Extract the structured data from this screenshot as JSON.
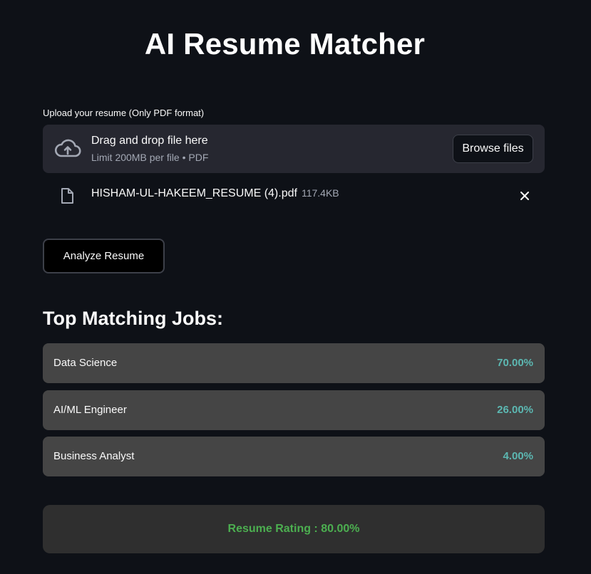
{
  "app": {
    "title": "AI Resume Matcher"
  },
  "uploader": {
    "label": "Upload your resume (Only PDF format)",
    "drop_title": "Drag and drop file here",
    "drop_subtitle": "Limit 200MB per file • PDF",
    "browse_label": "Browse files",
    "upload_icon": "cloud-upload-icon",
    "file": {
      "name": "HISHAM-UL-HAKEEM_RESUME (4).pdf",
      "size": "117.4KB",
      "icon": "file-icon"
    },
    "remove_icon": "close-icon"
  },
  "analyze": {
    "label": "Analyze Resume"
  },
  "results": {
    "heading": "Top Matching Jobs:",
    "jobs": [
      {
        "name": "Data Science",
        "match": "70.00%"
      },
      {
        "name": "AI/ML Engineer",
        "match": "26.00%"
      },
      {
        "name": "Business Analyst",
        "match": "4.00%"
      }
    ],
    "rating_text": "Resume Rating : 80.00%"
  },
  "colors": {
    "background": "#0e1117",
    "surface": "#262730",
    "job_card": "#454545",
    "match_accent": "#5cb8b2",
    "rating_green": "#4caf50"
  }
}
